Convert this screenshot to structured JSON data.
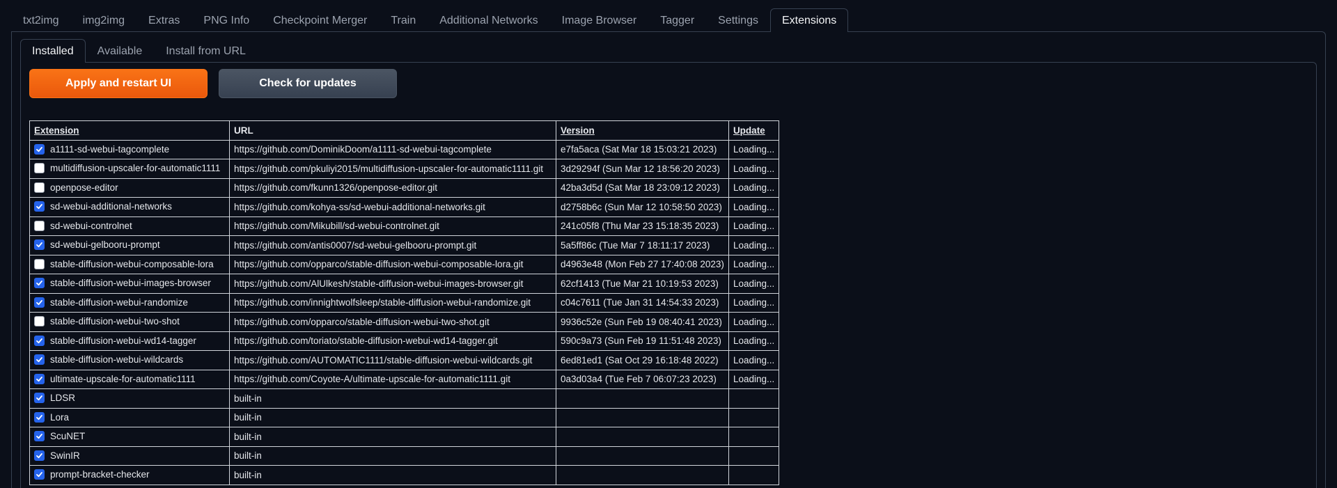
{
  "top_tabs": [
    "txt2img",
    "img2img",
    "Extras",
    "PNG Info",
    "Checkpoint Merger",
    "Train",
    "Additional Networks",
    "Image Browser",
    "Tagger",
    "Settings",
    "Extensions"
  ],
  "active_top_tab": "Extensions",
  "sub_tabs": [
    "Installed",
    "Available",
    "Install from URL"
  ],
  "active_sub_tab": "Installed",
  "buttons": {
    "apply": "Apply and restart UI",
    "check": "Check for updates"
  },
  "colors": {
    "accent": "#f97316",
    "checkbox_checked": "#2563eb",
    "background": "#0b0f19"
  },
  "table": {
    "headers": {
      "extension": "Extension",
      "url": "URL",
      "version": "Version",
      "update": "Update"
    },
    "rows": [
      {
        "checked": true,
        "name": "a1111-sd-webui-tagcomplete",
        "url": "https://github.com/DominikDoom/a1111-sd-webui-tagcomplete",
        "version": "e7fa5aca (Sat Mar 18 15:03:21 2023)",
        "update": "Loading..."
      },
      {
        "checked": false,
        "name": "multidiffusion-upscaler-for-automatic1111",
        "url": "https://github.com/pkuliyi2015/multidiffusion-upscaler-for-automatic1111.git",
        "version": "3d29294f (Sun Mar 12 18:56:20 2023)",
        "update": "Loading..."
      },
      {
        "checked": false,
        "name": "openpose-editor",
        "url": "https://github.com/fkunn1326/openpose-editor.git",
        "version": "42ba3d5d (Sat Mar 18 23:09:12 2023)",
        "update": "Loading..."
      },
      {
        "checked": true,
        "name": "sd-webui-additional-networks",
        "url": "https://github.com/kohya-ss/sd-webui-additional-networks.git",
        "version": "d2758b6c (Sun Mar 12 10:58:50 2023)",
        "update": "Loading..."
      },
      {
        "checked": false,
        "name": "sd-webui-controlnet",
        "url": "https://github.com/Mikubill/sd-webui-controlnet.git",
        "version": "241c05f8 (Thu Mar 23 15:18:35 2023)",
        "update": "Loading..."
      },
      {
        "checked": true,
        "name": "sd-webui-gelbooru-prompt",
        "url": "https://github.com/antis0007/sd-webui-gelbooru-prompt.git",
        "version": "5a5ff86c (Tue Mar 7 18:11:17 2023)",
        "update": "Loading..."
      },
      {
        "checked": false,
        "name": "stable-diffusion-webui-composable-lora",
        "url": "https://github.com/opparco/stable-diffusion-webui-composable-lora.git",
        "version": "d4963e48 (Mon Feb 27 17:40:08 2023)",
        "update": "Loading..."
      },
      {
        "checked": true,
        "name": "stable-diffusion-webui-images-browser",
        "url": "https://github.com/AlUlkesh/stable-diffusion-webui-images-browser.git",
        "version": "62cf1413 (Tue Mar 21 10:19:53 2023)",
        "update": "Loading..."
      },
      {
        "checked": true,
        "name": "stable-diffusion-webui-randomize",
        "url": "https://github.com/innightwolfsleep/stable-diffusion-webui-randomize.git",
        "version": "c04c7611 (Tue Jan 31 14:54:33 2023)",
        "update": "Loading..."
      },
      {
        "checked": false,
        "name": "stable-diffusion-webui-two-shot",
        "url": "https://github.com/opparco/stable-diffusion-webui-two-shot.git",
        "version": "9936c52e (Sun Feb 19 08:40:41 2023)",
        "update": "Loading..."
      },
      {
        "checked": true,
        "name": "stable-diffusion-webui-wd14-tagger",
        "url": "https://github.com/toriato/stable-diffusion-webui-wd14-tagger.git",
        "version": "590c9a73 (Sun Feb 19 11:51:48 2023)",
        "update": "Loading..."
      },
      {
        "checked": true,
        "name": "stable-diffusion-webui-wildcards",
        "url": "https://github.com/AUTOMATIC1111/stable-diffusion-webui-wildcards.git",
        "version": "6ed81ed1 (Sat Oct 29 16:18:48 2022)",
        "update": "Loading..."
      },
      {
        "checked": true,
        "name": "ultimate-upscale-for-automatic1111",
        "url": "https://github.com/Coyote-A/ultimate-upscale-for-automatic1111.git",
        "version": "0a3d03a4 (Tue Feb 7 06:07:23 2023)",
        "update": "Loading..."
      },
      {
        "checked": true,
        "name": "LDSR",
        "url": "built-in",
        "version": "",
        "update": ""
      },
      {
        "checked": true,
        "name": "Lora",
        "url": "built-in",
        "version": "",
        "update": ""
      },
      {
        "checked": true,
        "name": "ScuNET",
        "url": "built-in",
        "version": "",
        "update": ""
      },
      {
        "checked": true,
        "name": "SwinIR",
        "url": "built-in",
        "version": "",
        "update": ""
      },
      {
        "checked": true,
        "name": "prompt-bracket-checker",
        "url": "built-in",
        "version": "",
        "update": ""
      }
    ]
  }
}
